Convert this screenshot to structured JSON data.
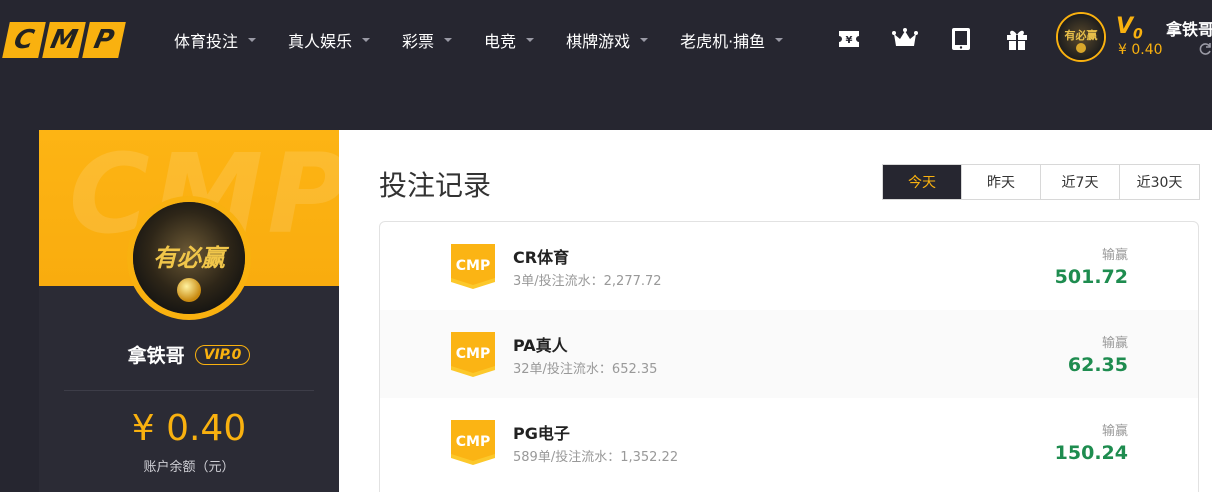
{
  "logo": {
    "letters": [
      "C",
      "M",
      "P"
    ]
  },
  "nav": {
    "items": [
      {
        "label": "体育投注"
      },
      {
        "label": "真人娱乐"
      },
      {
        "label": "彩票"
      },
      {
        "label": "电竞"
      },
      {
        "label": "棋牌游戏"
      },
      {
        "label": "老虎机·捕鱼"
      }
    ],
    "icons": [
      "ticket-icon",
      "crown-icon",
      "tablet-icon",
      "gift-icon"
    ]
  },
  "header_user": {
    "vip_letter": "V",
    "vip_level": "0",
    "balance": "¥ 0.40",
    "username": "拿铁哥"
  },
  "profile": {
    "watermark": "CMP",
    "name": "拿铁哥",
    "vip_badge": "VIP.0",
    "balance": "¥ 0.40",
    "balance_label": "账户余额（元）"
  },
  "main": {
    "title": "投注记录",
    "filters": [
      {
        "label": "今天",
        "active": true
      },
      {
        "label": "昨天",
        "active": false
      },
      {
        "label": "近7天",
        "active": false
      },
      {
        "label": "近30天",
        "active": false
      }
    ],
    "badge_text": "CMP",
    "win_label": "输赢",
    "records": [
      {
        "name": "CR体育",
        "sub": "3单/投注流水：2,277.72",
        "value": "501.72"
      },
      {
        "name": "PA真人",
        "sub": "32单/投注流水：652.35",
        "value": "62.35"
      },
      {
        "name": "PG电子",
        "sub": "589单/投注流水：1,352.22",
        "value": "150.24"
      }
    ]
  },
  "colors": {
    "accent": "#f9b10f",
    "dark": "#262630",
    "win": "#1e8c4f"
  }
}
